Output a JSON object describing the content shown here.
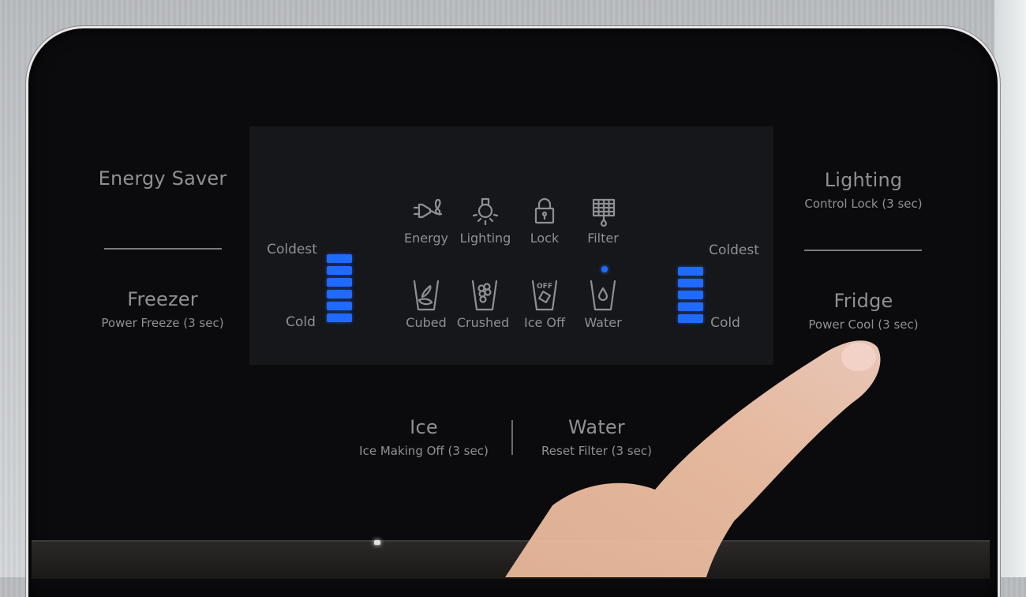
{
  "panel": {
    "left_buttons": {
      "top": {
        "title": "Energy Saver"
      },
      "bottom": {
        "title": "Freezer",
        "subtitle": "Power Freeze (3 sec)"
      }
    },
    "right_buttons": {
      "top": {
        "title": "Lighting",
        "subtitle": "Control Lock (3 sec)"
      },
      "bottom": {
        "title": "Fridge",
        "subtitle": "Power Cool (3 sec)"
      }
    },
    "bottom_buttons": [
      {
        "title": "Ice",
        "subtitle": "Ice Making Off (3 sec)"
      },
      {
        "title": "Water",
        "subtitle": "Reset Filter (3 sec)"
      }
    ]
  },
  "display": {
    "freezer_gauge": {
      "top_label": "Coldest",
      "bottom_label": "Cold",
      "lit_segments": 6,
      "total_segments": 6
    },
    "fridge_gauge": {
      "top_label": "Coldest",
      "bottom_label": "Cold",
      "lit_segments": 5,
      "total_segments": 5
    },
    "status_icons": [
      {
        "label": "Energy",
        "icon": "energy-plug-icon",
        "active": false
      },
      {
        "label": "Lighting",
        "icon": "light-bulb-icon",
        "active": false
      },
      {
        "label": "Lock",
        "icon": "lock-icon",
        "active": false
      },
      {
        "label": "Filter",
        "icon": "filter-icon",
        "active": false
      }
    ],
    "dispenser_modes": [
      {
        "label": "Cubed",
        "icon": "cubed-ice-cup-icon",
        "selected": false
      },
      {
        "label": "Crushed",
        "icon": "crushed-ice-cup-icon",
        "selected": false
      },
      {
        "label": "Ice Off",
        "icon": "ice-off-cup-icon",
        "selected": false,
        "icon_text": "OFF"
      },
      {
        "label": "Water",
        "icon": "water-cup-icon",
        "selected": true
      }
    ],
    "accent_color": "#1f6bff",
    "text_color": "#8f9094"
  }
}
